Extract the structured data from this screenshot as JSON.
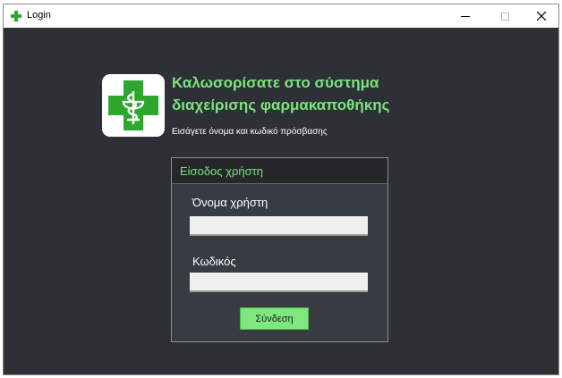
{
  "window": {
    "title": "Login",
    "controls": {
      "minimize_icon": "minimize-icon",
      "maximize_icon": "maximize-icon",
      "close_icon": "close-icon",
      "close_glyph": "✕"
    }
  },
  "branding": {
    "logo_icon": "pharmacy-cross-icon",
    "heading_line1": "Καλωσορίσατε στο σύστημα",
    "heading_line2": "διαχείρισης φαρμακαποθήκης",
    "subtitle": "Εισάγετε όνομα και κωδικό πρόσβασης"
  },
  "login_panel": {
    "header": "Είσοδος χρήστη",
    "username_label": "Όνομα χρήστη",
    "username_value": "",
    "password_label": "Κωδικός",
    "password_value": "",
    "submit_label": "Σύνδεση"
  },
  "colors": {
    "background": "#2d3035",
    "accent": "#7be47b",
    "panel": "#373b42",
    "panel_header": "#25272b",
    "button": "#7ee87e",
    "logo_cross": "#2fa72f"
  }
}
